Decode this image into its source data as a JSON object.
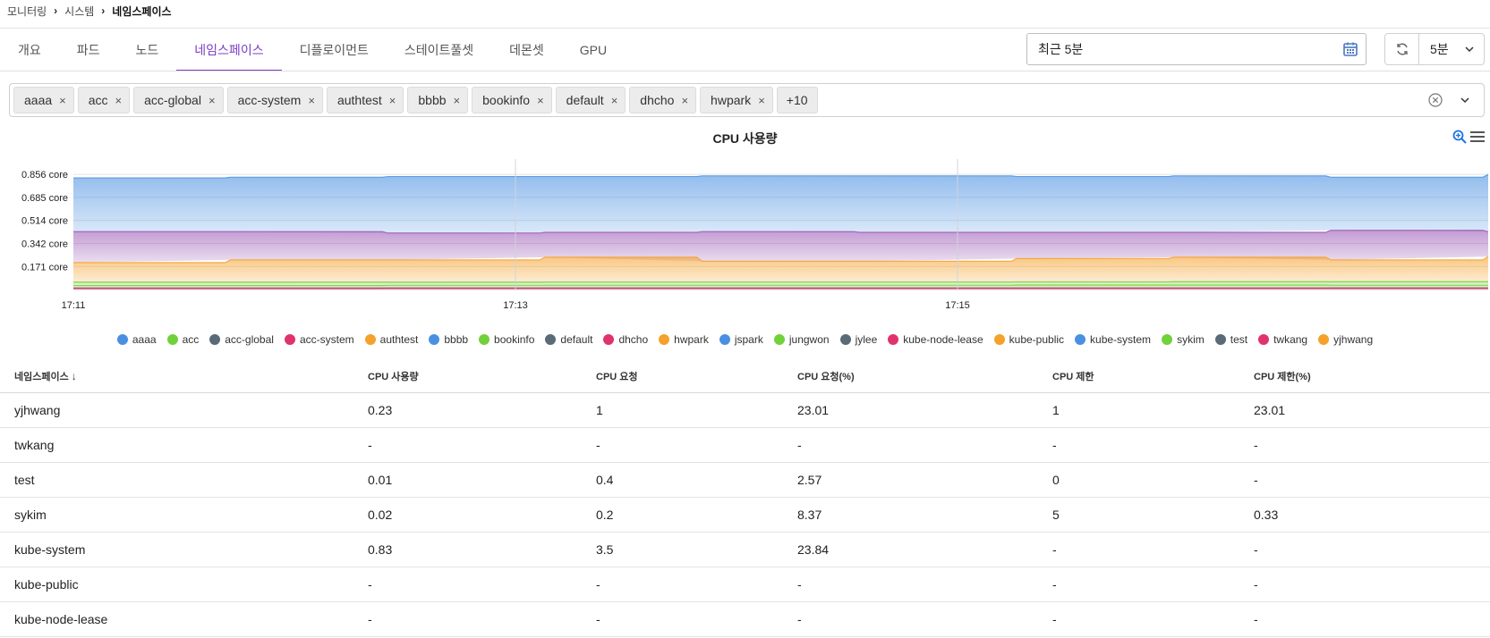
{
  "breadcrumb": [
    "모니터링",
    "시스템",
    "네임스페이스"
  ],
  "tabs": [
    {
      "label": "개요",
      "active": false
    },
    {
      "label": "파드",
      "active": false
    },
    {
      "label": "노드",
      "active": false
    },
    {
      "label": "네임스페이스",
      "active": true
    },
    {
      "label": "디플로이먼트",
      "active": false
    },
    {
      "label": "스테이트풀셋",
      "active": false
    },
    {
      "label": "데몬셋",
      "active": false
    },
    {
      "label": "GPU",
      "active": false
    }
  ],
  "time_range": {
    "value": "최근 5분",
    "icon": "calendar-icon"
  },
  "refresh": {
    "icon": "refresh-icon",
    "interval": "5분"
  },
  "filter": {
    "chips": [
      "aaaa",
      "acc",
      "acc-global",
      "acc-system",
      "authtest",
      "bbbb",
      "bookinfo",
      "default",
      "dhcho",
      "hwpark"
    ],
    "more_label": "+10",
    "remove_symbol": "×"
  },
  "chart_data": {
    "type": "area",
    "title": "CPU 사용량",
    "stacked": true,
    "x_ticks": [
      "17:11",
      "17:13",
      "17:15"
    ],
    "y_ticks": [
      "0.171 core",
      "0.342 core",
      "0.514 core",
      "0.685 core",
      "0.856 core"
    ],
    "ylim": [
      0,
      0.97
    ],
    "grid": true,
    "legend_position": "bottom",
    "series_colors": {
      "blue": "#4a90e2",
      "green": "#71d13b",
      "slate": "#5a6b78",
      "crimson": "#e0336b",
      "orange": "#f5a12c"
    },
    "series": [
      {
        "name": "aaaa",
        "color": "#4a90e2"
      },
      {
        "name": "acc",
        "color": "#71d13b"
      },
      {
        "name": "acc-global",
        "color": "#5a6b78"
      },
      {
        "name": "acc-system",
        "color": "#e0336b"
      },
      {
        "name": "authtest",
        "color": "#f5a12c"
      },
      {
        "name": "bbbb",
        "color": "#4a90e2"
      },
      {
        "name": "bookinfo",
        "color": "#71d13b"
      },
      {
        "name": "default",
        "color": "#5a6b78"
      },
      {
        "name": "dhcho",
        "color": "#e0336b"
      },
      {
        "name": "hwpark",
        "color": "#f5a12c"
      },
      {
        "name": "jspark",
        "color": "#4a90e2"
      },
      {
        "name": "jungwon",
        "color": "#71d13b"
      },
      {
        "name": "jylee",
        "color": "#5a6b78"
      },
      {
        "name": "kube-node-lease",
        "color": "#e0336b"
      },
      {
        "name": "kube-public",
        "color": "#f5a12c"
      },
      {
        "name": "kube-system",
        "color": "#4a90e2"
      },
      {
        "name": "sykim",
        "color": "#71d13b"
      },
      {
        "name": "test",
        "color": "#5a6b78"
      },
      {
        "name": "twkang",
        "color": "#e0336b"
      },
      {
        "name": "yjhwang",
        "color": "#f5a12c"
      }
    ],
    "bands": [
      {
        "name": "test/default",
        "color": "#5a6b78",
        "opacity": 0.25,
        "top": [
          [
            0,
            0.01
          ],
          [
            1,
            0.01
          ],
          [
            2,
            0.011
          ],
          [
            3,
            0.011
          ],
          [
            4,
            0.011
          ],
          [
            5,
            0.011
          ],
          [
            6,
            0.011
          ],
          [
            7,
            0.011
          ],
          [
            8,
            0.012
          ],
          [
            9,
            0.012
          ]
        ]
      },
      {
        "name": "sykim",
        "color": "#71d13b",
        "opacity": 0.3,
        "top": [
          [
            0,
            0.03
          ],
          [
            1,
            0.03
          ],
          [
            2,
            0.031
          ],
          [
            3,
            0.032
          ],
          [
            4,
            0.032
          ],
          [
            5,
            0.032
          ],
          [
            6,
            0.033
          ],
          [
            7,
            0.033
          ],
          [
            8,
            0.032
          ],
          [
            9,
            0.032
          ]
        ]
      },
      {
        "name": "jungwon",
        "color": "#71d13b",
        "opacity": 0.3,
        "top": [
          [
            0,
            0.055
          ],
          [
            1,
            0.055
          ],
          [
            2,
            0.055
          ],
          [
            3,
            0.056
          ],
          [
            4,
            0.056
          ],
          [
            5,
            0.056
          ],
          [
            6,
            0.057
          ],
          [
            7,
            0.058
          ],
          [
            8,
            0.058
          ],
          [
            9,
            0.058
          ]
        ]
      },
      {
        "name": "yjhwang/hwpark",
        "color": "#f5a12c",
        "opacity": 0.45,
        "top": [
          [
            0,
            0.2
          ],
          [
            1,
            0.22
          ],
          [
            2,
            0.22
          ],
          [
            3,
            0.24
          ],
          [
            4,
            0.21
          ],
          [
            5,
            0.21
          ],
          [
            6,
            0.23
          ],
          [
            7,
            0.24
          ],
          [
            8,
            0.22
          ],
          [
            9,
            0.245
          ]
        ]
      },
      {
        "name": "acc-system/dhcho",
        "color": "#9b59b6",
        "opacity": 0.45,
        "top": [
          [
            0,
            0.43
          ],
          [
            1,
            0.43
          ],
          [
            2,
            0.42
          ],
          [
            3,
            0.425
          ],
          [
            4,
            0.43
          ],
          [
            5,
            0.425
          ],
          [
            6,
            0.425
          ],
          [
            7,
            0.425
          ],
          [
            8,
            0.44
          ],
          [
            9,
            0.43
          ]
        ]
      },
      {
        "name": "kube-system",
        "color": "#4a90e2",
        "opacity": 0.45,
        "top": [
          [
            0,
            0.83
          ],
          [
            1,
            0.835
          ],
          [
            2,
            0.84
          ],
          [
            3,
            0.84
          ],
          [
            4,
            0.845
          ],
          [
            5,
            0.845
          ],
          [
            6,
            0.84
          ],
          [
            7,
            0.845
          ],
          [
            8,
            0.835
          ],
          [
            9,
            0.855
          ]
        ]
      }
    ]
  },
  "table": {
    "columns": [
      "네임스페이스",
      "CPU 사용량",
      "CPU 요청",
      "CPU 요청(%)",
      "CPU 제한",
      "CPU 제한(%)"
    ],
    "sort_indicator": "↓",
    "rows": [
      [
        "yjhwang",
        "0.23",
        "1",
        "23.01",
        "1",
        "23.01"
      ],
      [
        "twkang",
        "-",
        "-",
        "-",
        "-",
        "-"
      ],
      [
        "test",
        "0.01",
        "0.4",
        "2.57",
        "0",
        "-"
      ],
      [
        "sykim",
        "0.02",
        "0.2",
        "8.37",
        "5",
        "0.33"
      ],
      [
        "kube-system",
        "0.83",
        "3.5",
        "23.84",
        "-",
        "-"
      ],
      [
        "kube-public",
        "-",
        "-",
        "-",
        "-",
        "-"
      ],
      [
        "kube-node-lease",
        "-",
        "-",
        "-",
        "-",
        "-"
      ]
    ]
  },
  "accent_color": "#7b3fc4"
}
